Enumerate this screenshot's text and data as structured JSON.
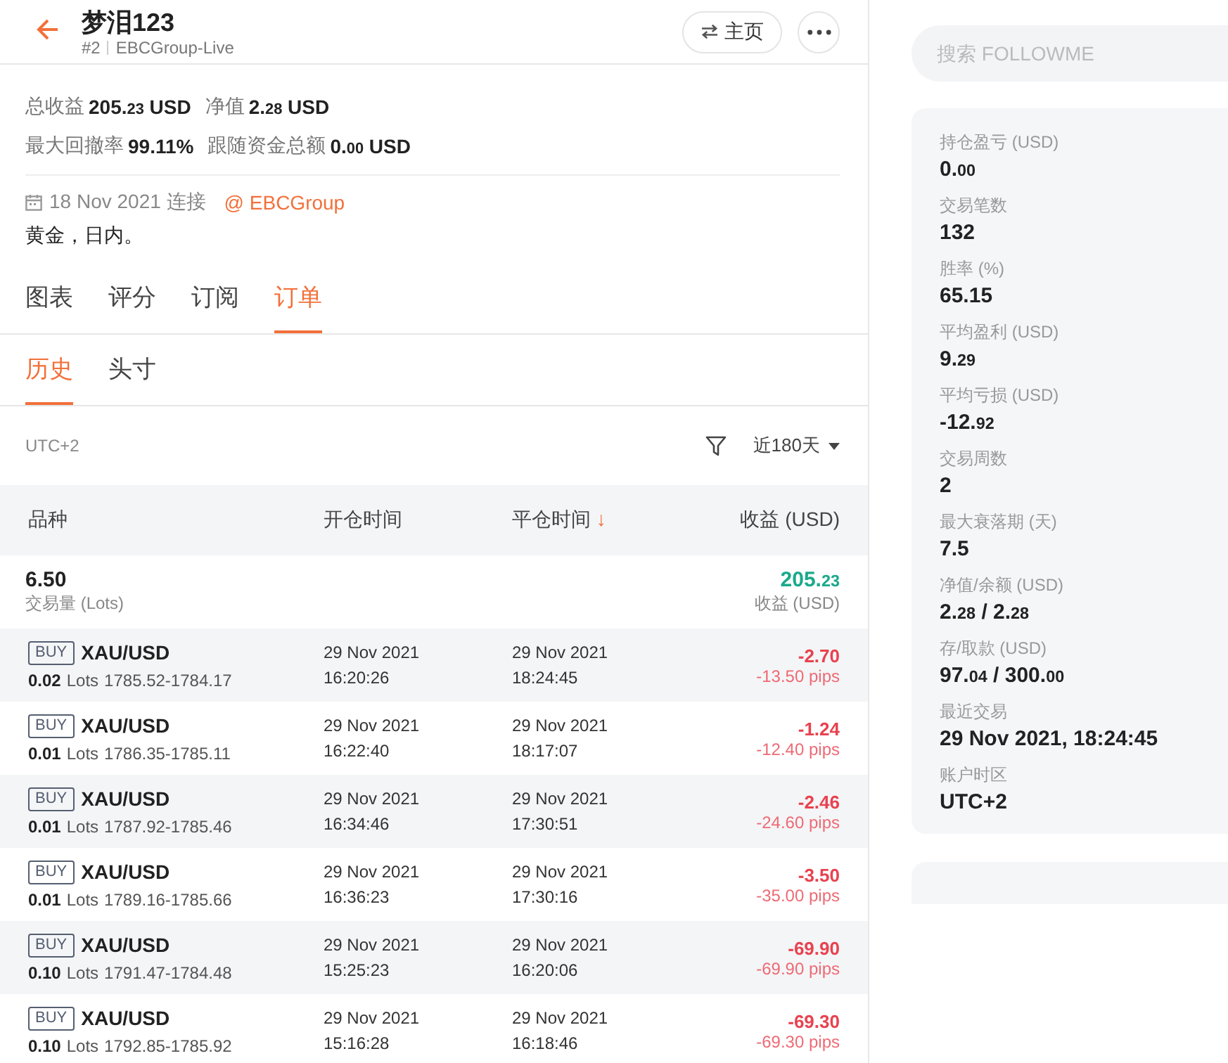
{
  "header": {
    "title": "梦泪123",
    "rank": "#2",
    "broker": "EBCGroup-Live",
    "home_button": "主页"
  },
  "summary": [
    {
      "label": "总收益",
      "value": [
        {
          "text": "205.",
          "small": false
        },
        {
          "text": "23",
          "small": true
        },
        {
          "text": " USD",
          "small": false
        }
      ]
    },
    {
      "label": "净值",
      "value": [
        {
          "text": "2.",
          "small": false
        },
        {
          "text": "28",
          "small": true
        },
        {
          "text": " USD",
          "small": false
        }
      ]
    },
    {
      "label": "最大回撤率",
      "value": [
        {
          "text": "99.11%",
          "small": false
        }
      ]
    },
    {
      "label": "跟随资金总额",
      "value": [
        {
          "text": "0.",
          "small": false
        },
        {
          "text": "00",
          "small": true
        },
        {
          "text": " USD",
          "small": false
        }
      ]
    }
  ],
  "connected": "18 Nov 2021 连接",
  "broker_link": "@ EBCGroup",
  "description": "黄金，日内。",
  "tabs": [
    {
      "label": "图表",
      "selected": false
    },
    {
      "label": "评分",
      "selected": false
    },
    {
      "label": "订阅",
      "selected": false
    },
    {
      "label": "订单",
      "selected": true
    }
  ],
  "subtabs": [
    {
      "label": "历史",
      "selected": true
    },
    {
      "label": "头寸",
      "selected": false
    }
  ],
  "timezone": "UTC+2",
  "period": "近180天",
  "table": {
    "columns": [
      "品种",
      "开仓时间",
      "平仓时间",
      "收益 (USD)"
    ],
    "sort_mark": "↓",
    "total": {
      "lots": "6.50",
      "lots_label": "交易量 (Lots)",
      "profit": [
        {
          "text": "205.",
          "small": false
        },
        {
          "text": "23",
          "small": true
        }
      ],
      "profit_label": "收益 (USD)"
    },
    "rows": [
      {
        "side": "BUY",
        "symbol": "XAU/USD",
        "lots": "0.02",
        "lots_unit": "Lots",
        "prices": "1785.52-1784.17",
        "open_date": "29 Nov 2021",
        "open_time": "16:20:26",
        "close_date": "29 Nov 2021",
        "close_time": "18:24:45",
        "profit": "-2.70",
        "pips": "-13.50 pips"
      },
      {
        "side": "BUY",
        "symbol": "XAU/USD",
        "lots": "0.01",
        "lots_unit": "Lots",
        "prices": "1786.35-1785.11",
        "open_date": "29 Nov 2021",
        "open_time": "16:22:40",
        "close_date": "29 Nov 2021",
        "close_time": "18:17:07",
        "profit": "-1.24",
        "pips": "-12.40 pips"
      },
      {
        "side": "BUY",
        "symbol": "XAU/USD",
        "lots": "0.01",
        "lots_unit": "Lots",
        "prices": "1787.92-1785.46",
        "open_date": "29 Nov 2021",
        "open_time": "16:34:46",
        "close_date": "29 Nov 2021",
        "close_time": "17:30:51",
        "profit": "-2.46",
        "pips": "-24.60 pips"
      },
      {
        "side": "BUY",
        "symbol": "XAU/USD",
        "lots": "0.01",
        "lots_unit": "Lots",
        "prices": "1789.16-1785.66",
        "open_date": "29 Nov 2021",
        "open_time": "16:36:23",
        "close_date": "29 Nov 2021",
        "close_time": "17:30:16",
        "profit": "-3.50",
        "pips": "-35.00 pips"
      },
      {
        "side": "BUY",
        "symbol": "XAU/USD",
        "lots": "0.10",
        "lots_unit": "Lots",
        "prices": "1791.47-1784.48",
        "open_date": "29 Nov 2021",
        "open_time": "15:25:23",
        "close_date": "29 Nov 2021",
        "close_time": "16:20:06",
        "profit": "-69.90",
        "pips": "-69.90 pips"
      },
      {
        "side": "BUY",
        "symbol": "XAU/USD",
        "lots": "0.10",
        "lots_unit": "Lots",
        "prices": "1792.85-1785.92",
        "open_date": "29 Nov 2021",
        "open_time": "15:16:28",
        "close_date": "29 Nov 2021",
        "close_time": "16:18:46",
        "profit": "-69.30",
        "pips": "-69.30 pips"
      }
    ]
  },
  "search": {
    "placeholder": "搜索 FOLLOWME"
  },
  "stats": [
    {
      "label": "持仓盈亏 (USD)",
      "value": [
        {
          "text": "0.",
          "small": false
        },
        {
          "text": "00",
          "small": true
        }
      ]
    },
    {
      "label": "交易笔数",
      "value": [
        {
          "text": "132",
          "small": false
        }
      ]
    },
    {
      "label": "胜率 (%)",
      "value": [
        {
          "text": "65.15",
          "small": false
        }
      ]
    },
    {
      "label": "平均盈利 (USD)",
      "value": [
        {
          "text": "9.",
          "small": false
        },
        {
          "text": "29",
          "small": true
        }
      ]
    },
    {
      "label": "平均亏损 (USD)",
      "value": [
        {
          "text": "-12.",
          "small": false
        },
        {
          "text": "92",
          "small": true
        }
      ]
    },
    {
      "label": "交易周数",
      "value": [
        {
          "text": "2",
          "small": false
        }
      ]
    },
    {
      "label": "最大衰落期 (天)",
      "value": [
        {
          "text": "7.5",
          "small": false
        }
      ]
    },
    {
      "label": "净值/余额 (USD)",
      "value": [
        {
          "text": "2.",
          "small": false
        },
        {
          "text": "28",
          "small": true
        },
        {
          "text": " / 2.",
          "small": false
        },
        {
          "text": "28",
          "small": true
        }
      ]
    },
    {
      "label": "存/取款 (USD)",
      "value": [
        {
          "text": "97.",
          "small": false
        },
        {
          "text": "04",
          "small": true
        },
        {
          "text": " / 300.",
          "small": false
        },
        {
          "text": "00",
          "small": true
        }
      ]
    },
    {
      "label": "最近交易",
      "value": [
        {
          "text": "29 Nov 2021, 18:24:45",
          "small": false
        }
      ]
    },
    {
      "label": "账户时区",
      "value": [
        {
          "text": "UTC+2",
          "small": false
        }
      ]
    }
  ]
}
